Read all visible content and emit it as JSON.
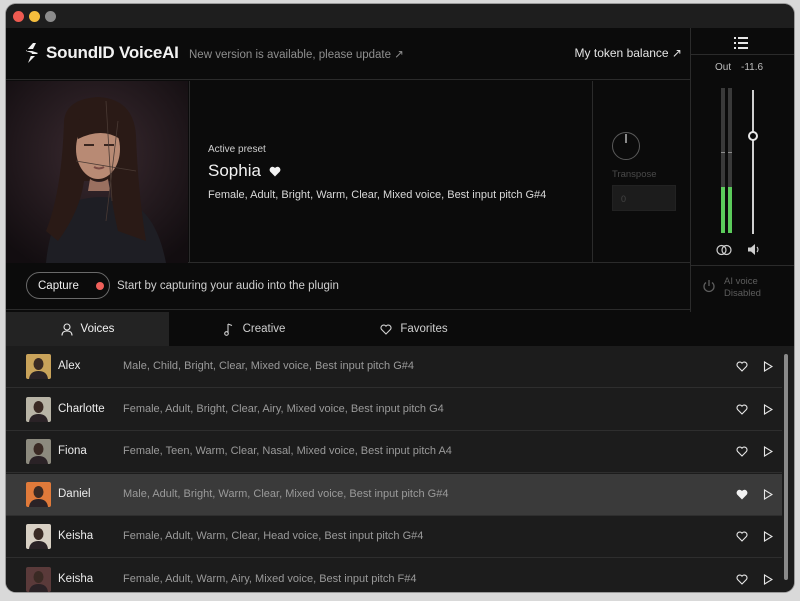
{
  "app": {
    "brand": "SoundID VoiceAI",
    "update_notice": "New version is available, please update ↗",
    "token_balance": "My token balance ↗"
  },
  "meter": {
    "out_label": "Out",
    "out_value": "-11.6",
    "left_level": 0.32,
    "right_level": 0.32,
    "volume_level": 0.67,
    "ai_voice_line1": "AI voice",
    "ai_voice_line2": "Disabled"
  },
  "preset": {
    "label": "Active preset",
    "name": "Sophia",
    "description": "Female, Adult, Bright, Warm, Clear, Mixed voice, Best input pitch  G#4",
    "transpose_label": "Transpose",
    "transpose_value": "0"
  },
  "capture": {
    "button_label": "Capture",
    "hint": "Start by capturing your audio into the plugin"
  },
  "tabs": [
    {
      "label": "Voices",
      "active": true
    },
    {
      "label": "Creative",
      "active": false
    },
    {
      "label": "Favorites",
      "active": false
    }
  ],
  "voices": [
    {
      "name": "Alex",
      "description": "Male, Child, Bright, Clear, Mixed voice, Best input pitch G#4",
      "favorite": false,
      "selected": false,
      "avatar_color": "#c9a35a"
    },
    {
      "name": "Charlotte",
      "description": "Female, Adult, Bright, Clear, Airy, Mixed voice, Best input pitch  G4",
      "favorite": false,
      "selected": false,
      "avatar_color": "#b8b4a6"
    },
    {
      "name": "Fiona",
      "description": "Female, Teen, Warm, Clear, Nasal, Mixed voice, Best input pitch  A4",
      "favorite": false,
      "selected": false,
      "avatar_color": "#8c8a7e"
    },
    {
      "name": "Daniel",
      "description": "Male, Adult, Bright, Warm, Clear, Mixed voice, Best input pitch  G#4",
      "favorite": true,
      "selected": true,
      "avatar_color": "#e07a3a"
    },
    {
      "name": "Keisha",
      "description": "Female, Adult, Warm, Clear, Head voice, Best input pitch  G#4",
      "favorite": false,
      "selected": false,
      "avatar_color": "#d8d0c4"
    },
    {
      "name": "Keisha",
      "description": "Female, Adult, Warm, Airy, Mixed voice, Best input pitch  F#4",
      "favorite": false,
      "selected": false,
      "avatar_color": "#5a3a3a"
    }
  ]
}
